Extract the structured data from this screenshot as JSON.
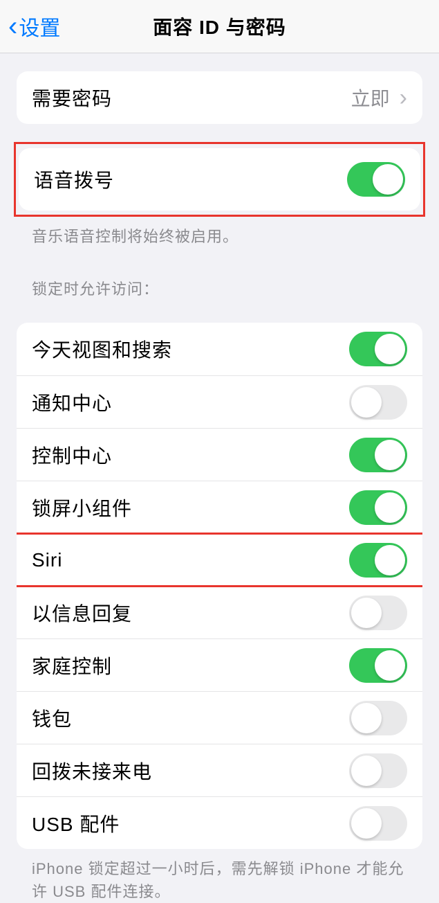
{
  "nav": {
    "back_label": "设置",
    "title": "面容 ID 与密码"
  },
  "group1": {
    "require_passcode_label": "需要密码",
    "require_passcode_value": "立即"
  },
  "voice_dial": {
    "label": "语音拨号",
    "footer": "音乐语音控制将始终被启用。"
  },
  "lock_access": {
    "header": "锁定时允许访问：",
    "items": [
      {
        "label": "今天视图和搜索",
        "on": true
      },
      {
        "label": "通知中心",
        "on": false
      },
      {
        "label": "控制中心",
        "on": true
      },
      {
        "label": "锁屏小组件",
        "on": true
      },
      {
        "label": "Siri",
        "on": true
      },
      {
        "label": "以信息回复",
        "on": false
      },
      {
        "label": "家庭控制",
        "on": true
      },
      {
        "label": "钱包",
        "on": false
      },
      {
        "label": "回拨未接来电",
        "on": false
      },
      {
        "label": "USB 配件",
        "on": false
      }
    ],
    "footer": "iPhone 锁定超过一小时后，需先解锁 iPhone 才能允许 USB 配件连接。"
  }
}
